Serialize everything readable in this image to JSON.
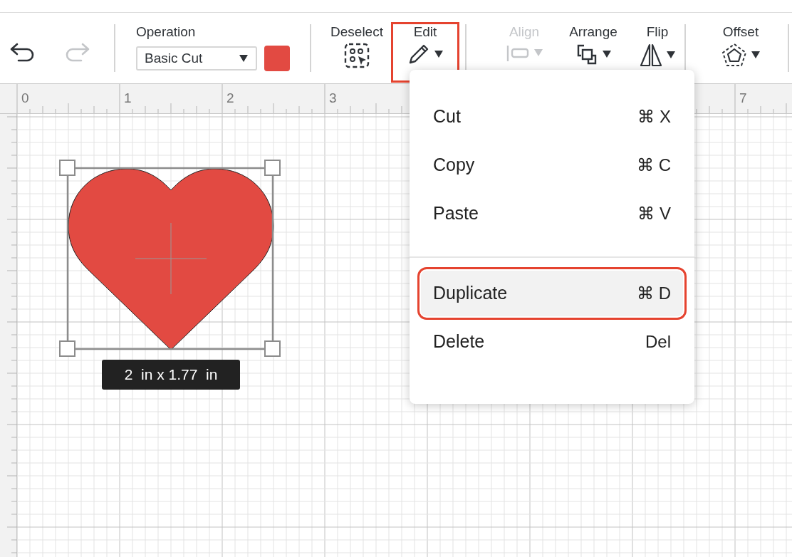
{
  "toolbar": {
    "undo": {
      "disabled": false
    },
    "redo": {
      "disabled": true
    },
    "operation": {
      "label": "Operation",
      "value": "Basic Cut"
    },
    "tools": [
      {
        "kind": "deselect",
        "label": "Deselect",
        "disabled": false,
        "highlighted": false,
        "dropdown": false
      },
      {
        "kind": "edit",
        "label": "Edit",
        "disabled": false,
        "highlighted": true,
        "dropdown": true
      },
      {
        "kind": "align",
        "label": "Align",
        "disabled": true,
        "highlighted": false,
        "dropdown": true
      },
      {
        "kind": "arrange",
        "label": "Arrange",
        "disabled": false,
        "highlighted": false,
        "dropdown": true
      },
      {
        "kind": "flip",
        "label": "Flip",
        "disabled": false,
        "highlighted": false,
        "dropdown": true
      },
      {
        "kind": "offset",
        "label": "Offset",
        "disabled": false,
        "highlighted": false,
        "dropdown": true
      }
    ]
  },
  "ruler_labels": [
    "0",
    "1",
    "2",
    "3",
    "7"
  ],
  "selection": {
    "dimensions": "2  in x 1.77  in"
  },
  "edit_menu": {
    "sections": [
      [
        {
          "label": "Cut",
          "shortcut": "⌘ X",
          "selected": false,
          "highlighted": false
        },
        {
          "label": "Copy",
          "shortcut": "⌘ C",
          "selected": false,
          "highlighted": false
        },
        {
          "label": "Paste",
          "shortcut": "⌘ V",
          "selected": false,
          "highlighted": false
        }
      ],
      [
        {
          "label": "Duplicate",
          "shortcut": "⌘ D",
          "selected": true,
          "highlighted": true
        },
        {
          "label": "Delete",
          "shortcut": "Del",
          "selected": false,
          "highlighted": false
        }
      ]
    ]
  }
}
